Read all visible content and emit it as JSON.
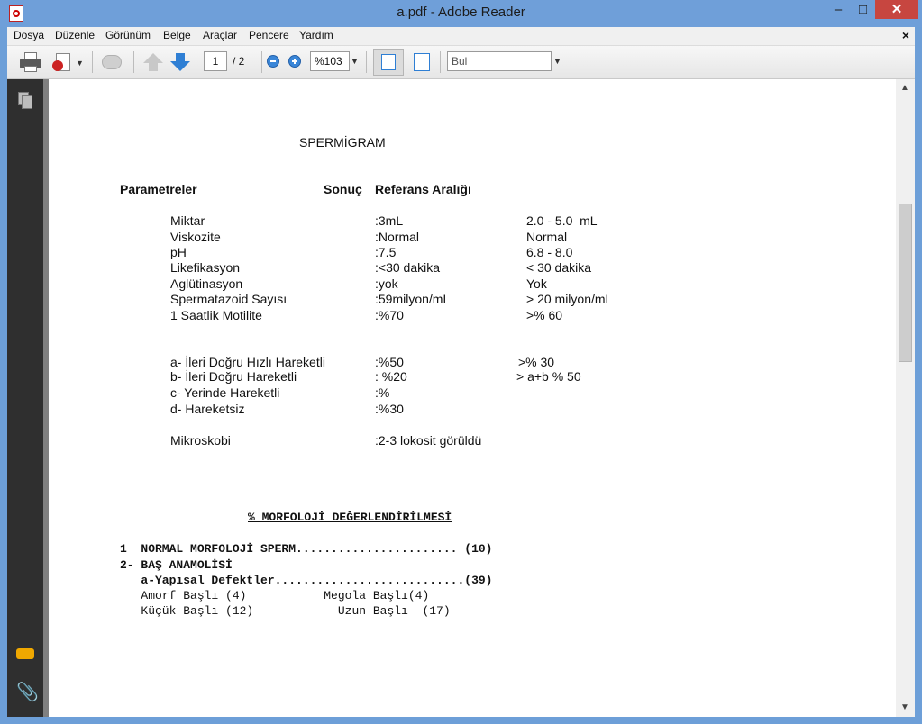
{
  "window": {
    "title": "a.pdf - Adobe Reader",
    "min": "–",
    "max": "□",
    "close": "✕"
  },
  "menu": {
    "items": [
      "Dosya",
      "Düzenle",
      "Görünüm",
      "Belge",
      "Araçlar",
      "Pencere",
      "Yardım"
    ],
    "close": "×"
  },
  "toolbar": {
    "page_current": "1",
    "page_total": "/ 2",
    "zoom": "%103",
    "search_placeholder": "Bul"
  },
  "doc": {
    "title": "SPERMİGRAM",
    "headers": {
      "param": "Parametreler",
      "result": "Sonuç",
      "ref": "Referans Aralığı"
    },
    "rows": [
      {
        "name": "Miktar",
        "result": ":3mL",
        "ref": "2.0 - 5.0  mL"
      },
      {
        "name": "Viskozite",
        "result": ":Normal",
        "ref": "Normal"
      },
      {
        "name": "pH",
        "result": ":7.5",
        "ref": "6.8 - 8.0"
      },
      {
        "name": "Likefikasyon",
        "result": ":<30 dakika",
        "ref": "< 30 dakika"
      },
      {
        "name": "Aglütinasyon",
        "result": ":yok",
        "ref": "Yok"
      },
      {
        "name": "Spermatazoid Sayısı",
        "result": ":59milyon/mL",
        "ref": "> 20 milyon/mL"
      },
      {
        "name": "1 Saatlik Motilite",
        "result": ":%70",
        "ref": ">% 60"
      }
    ],
    "motility": [
      {
        "name": "a- İleri Doğru Hızlı Hareketli",
        "result": ":%50",
        "ref": ">% 30"
      },
      {
        "name": "b- İleri Doğru Hareketli",
        "result": ": %20",
        "ref": "> a+b % 50"
      },
      {
        "name": "c- Yerinde Hareketli",
        "result": ":%",
        "ref": ""
      },
      {
        "name": "d- Hareketsiz",
        "result": ":%30",
        "ref": ""
      }
    ],
    "micro": {
      "name": "Mikroskobi",
      "result": ":2-3 lokosit görüldü"
    },
    "morph_title": "% MORFOLOJİ DEĞERLENDİRİLMESİ",
    "morph_lines": [
      "1  NORMAL MORFOLOJİ SPERM....................... (10)",
      "2- BAŞ ANAMOLİSİ",
      "   a-Yapısal Defektler...........................(39)",
      "   Amorf Başlı (4)           Megola Başlı(4)",
      "   Küçük Başlı (12)            Uzun Başlı  (17)"
    ]
  }
}
